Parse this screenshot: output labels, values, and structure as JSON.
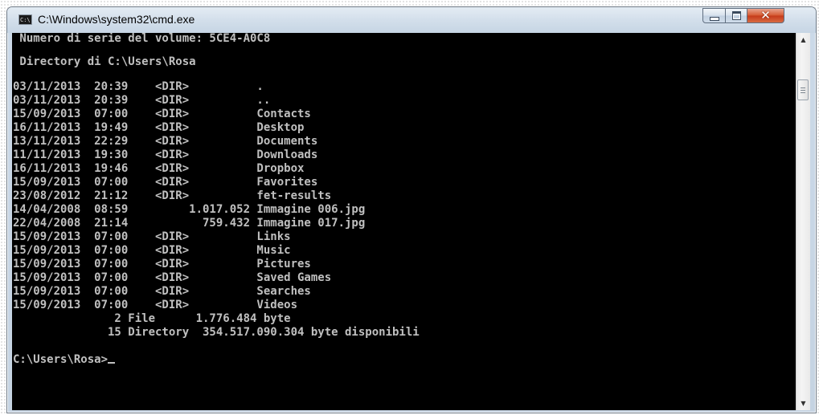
{
  "window": {
    "title": "C:\\Windows\\system32\\cmd.exe",
    "icon": "console-icon",
    "icon_text": "C:\\"
  },
  "controls": {
    "minimize": "minimize-icon",
    "maximize": "maximize-icon",
    "close": "close-icon",
    "close_glyph": "✕"
  },
  "console": {
    "lines": [
      " Numero di serie del volume: 5CE4-A0C8",
      "",
      " Directory di C:\\Users\\Rosa",
      "",
      "03/11/2013  20:39    <DIR>          .",
      "03/11/2013  20:39    <DIR>          ..",
      "15/09/2013  07:00    <DIR>          Contacts",
      "16/11/2013  19:49    <DIR>          Desktop",
      "13/11/2013  22:29    <DIR>          Documents",
      "11/11/2013  19:30    <DIR>          Downloads",
      "16/11/2013  19:46    <DIR>          Dropbox",
      "15/09/2013  07:00    <DIR>          Favorites",
      "23/08/2012  21:12    <DIR>          fet-results",
      "14/04/2008  08:59         1.017.052 Immagine 006.jpg",
      "22/04/2008  21:14           759.432 Immagine 017.jpg",
      "15/09/2013  07:00    <DIR>          Links",
      "15/09/2013  07:00    <DIR>          Music",
      "15/09/2013  07:00    <DIR>          Pictures",
      "15/09/2013  07:00    <DIR>          Saved Games",
      "15/09/2013  07:00    <DIR>          Searches",
      "15/09/2013  07:00    <DIR>          Videos",
      "               2 File      1.776.484 byte",
      "              15 Directory  354.517.090.304 byte disponibili",
      "",
      "C:\\Users\\Rosa>"
    ]
  },
  "scrollbar": {
    "up_arrow": "▲",
    "down_arrow": "▼"
  },
  "colors": {
    "console_bg": "#000000",
    "console_text": "#c0c0c0",
    "close_button": "#c5391a"
  }
}
